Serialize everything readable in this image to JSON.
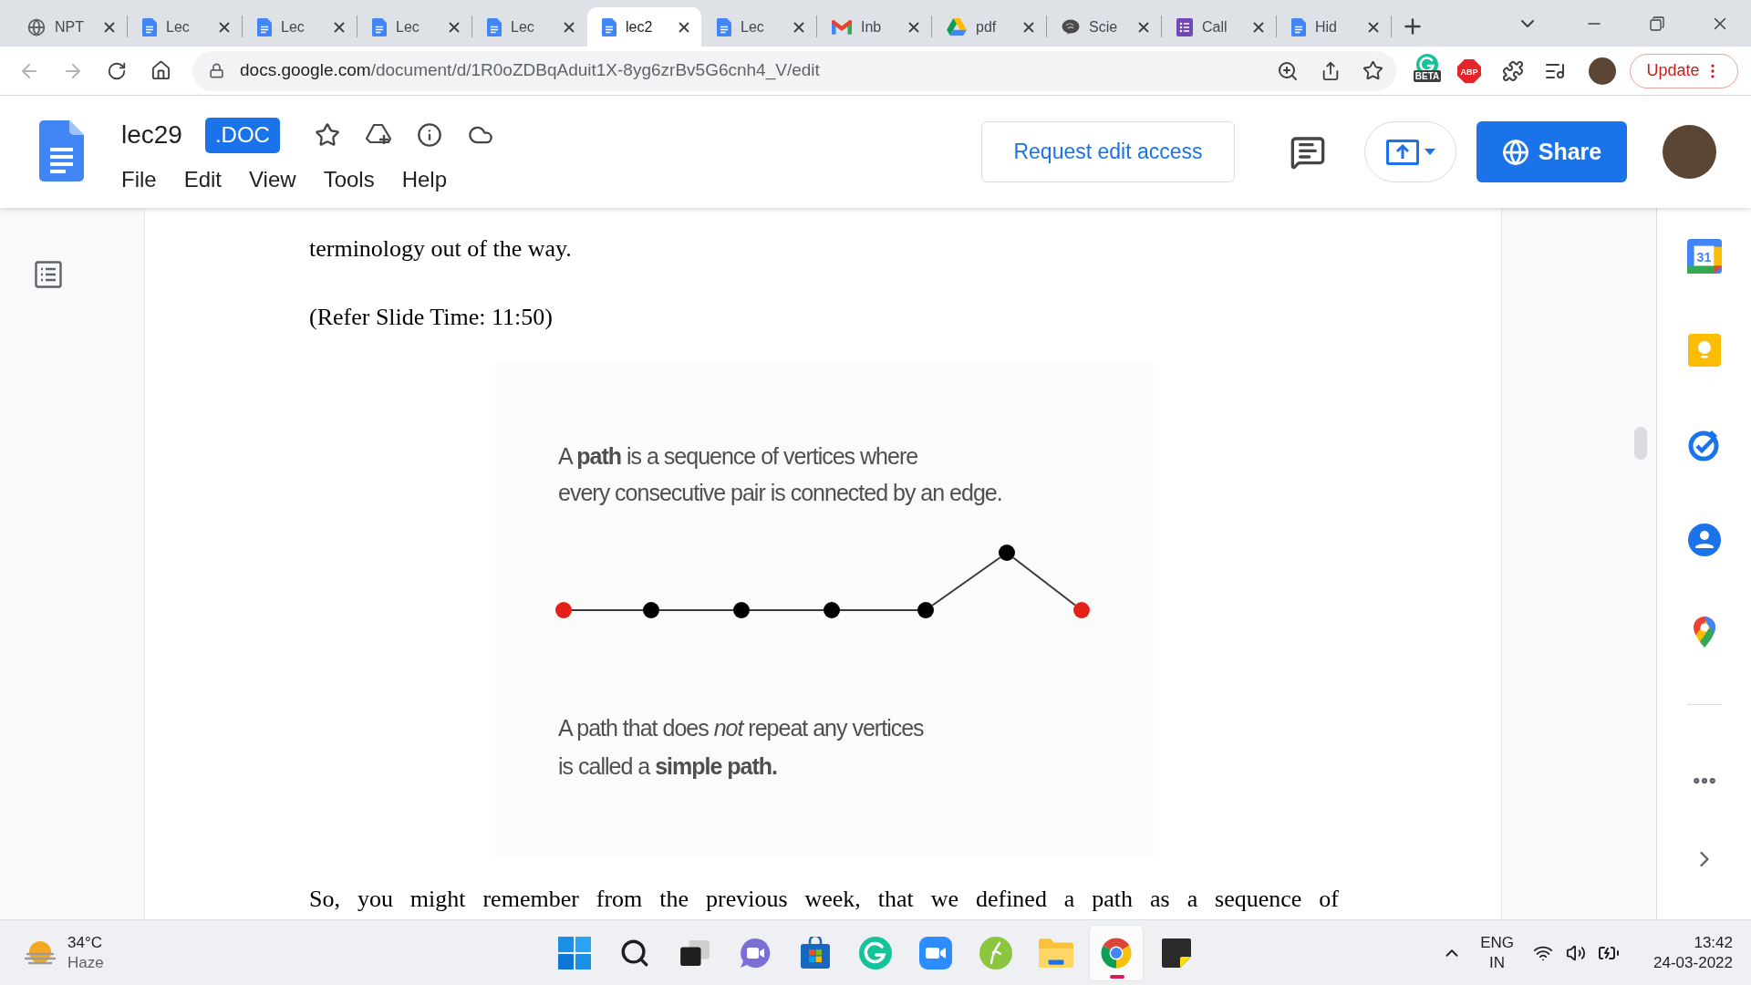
{
  "browser": {
    "tabs": [
      {
        "title": "NPT",
        "kind": "web",
        "selected": false
      },
      {
        "title": "Lec",
        "kind": "doc",
        "selected": false
      },
      {
        "title": "Lec",
        "kind": "doc",
        "selected": false
      },
      {
        "title": "Lec",
        "kind": "doc",
        "selected": false
      },
      {
        "title": "Lec",
        "kind": "doc",
        "selected": false
      },
      {
        "title": "lec2",
        "kind": "doc",
        "selected": true
      },
      {
        "title": "Lec",
        "kind": "doc",
        "selected": false
      },
      {
        "title": "Inb",
        "kind": "mail",
        "selected": false
      },
      {
        "title": "pdf",
        "kind": "drive",
        "selected": false
      },
      {
        "title": "Scie",
        "kind": "site",
        "selected": false
      },
      {
        "title": "Call",
        "kind": "form",
        "selected": false
      },
      {
        "title": "Hid",
        "kind": "doc",
        "selected": false
      }
    ],
    "address_bar": {
      "host": "docs.google.com",
      "path": "/document/d/1R0oZDBqAduit1X-8yg6zrBv5G6cnh4_V/edit"
    },
    "extensions": {
      "beta_label": "BETA",
      "adblock_label": "ABP"
    },
    "update_button": "Update"
  },
  "docs_header": {
    "title": "lec29",
    "file_type": ".DOC",
    "menu": [
      "File",
      "Edit",
      "View",
      "Tools",
      "Help"
    ],
    "request_button": "Request edit access",
    "share_button": "Share"
  },
  "document": {
    "paragraphs": [
      "terminology out of the way.",
      "(Refer Slide Time: 11:50)"
    ],
    "slide": {
      "definition": [
        "A **path** is a sequence of vertices where",
        "every consecutive pair is connected by an edge."
      ],
      "vertices": [
        {
          "color": "#e32119"
        },
        {
          "color": "#000000"
        },
        {
          "color": "#000000"
        },
        {
          "color": "#000000"
        },
        {
          "color": "#000000"
        },
        {
          "color": "#000000"
        },
        {
          "color": "#e32119"
        }
      ],
      "note": [
        "A path that does *not* repeat any vertices",
        "is called a **simple path.**"
      ]
    },
    "closing_paragraph": "So, you might remember from the previous week, that we defined a path as a sequence of"
  },
  "side_panel": {
    "calendar_date": "31"
  },
  "taskbar": {
    "weather": {
      "temperature": "34°C",
      "condition": "Haze"
    },
    "apps": [
      {
        "kind": "start",
        "active": false
      },
      {
        "kind": "search",
        "active": false
      },
      {
        "kind": "taskview",
        "active": false
      },
      {
        "kind": "chat",
        "active": false
      },
      {
        "kind": "store",
        "active": false
      },
      {
        "kind": "grammar",
        "active": false
      },
      {
        "kind": "meeting",
        "active": false
      },
      {
        "kind": "leaf",
        "active": false
      },
      {
        "kind": "folder",
        "active": false
      },
      {
        "kind": "browser",
        "active": true
      },
      {
        "kind": "notes",
        "active": false
      }
    ],
    "language": {
      "primary": "ENG",
      "region": "IN"
    },
    "clock": {
      "time": "13:42",
      "date": "24-03-2022"
    }
  }
}
